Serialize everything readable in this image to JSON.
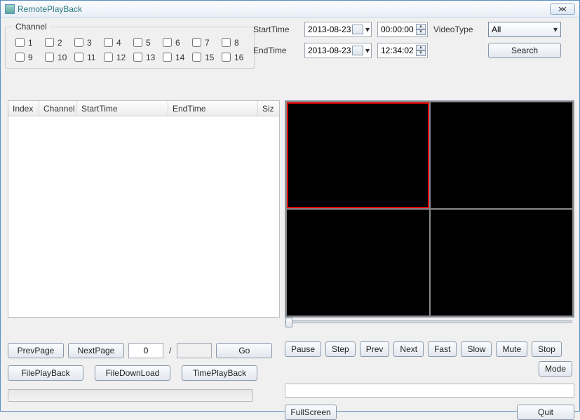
{
  "window": {
    "title": "RemotePlayBack"
  },
  "channels": {
    "legend": "Channel",
    "items": [
      "1",
      "2",
      "3",
      "4",
      "5",
      "6",
      "7",
      "8",
      "9",
      "10",
      "11",
      "12",
      "13",
      "14",
      "15",
      "16"
    ]
  },
  "time": {
    "start_label": "StartTime",
    "end_label": "EndTime",
    "start_date": "2013-08-23",
    "start_time": "00:00:00",
    "end_date": "2013-08-23",
    "end_time": "12:34:02"
  },
  "videotype": {
    "label": "VideoType",
    "value": "All"
  },
  "search": {
    "label": "Search"
  },
  "table": {
    "cols": {
      "index": "Index",
      "channel": "Channel",
      "starttime": "StartTime",
      "endtime": "EndTime",
      "size": "Siz"
    }
  },
  "pager": {
    "prev": "PrevPage",
    "next": "NextPage",
    "current": "0",
    "total": "",
    "go": "Go"
  },
  "filebtns": {
    "play": "FilePlayBack",
    "download": "FileDownLoad",
    "time": "TimePlayBack"
  },
  "controls": {
    "pause": "Pause",
    "step": "Step",
    "prev": "Prev",
    "next": "Next",
    "fast": "Fast",
    "slow": "Slow",
    "mute": "Mute",
    "stop": "Stop",
    "mode": "Mode",
    "fullscreen": "FullScreen",
    "quit": "Quit"
  }
}
